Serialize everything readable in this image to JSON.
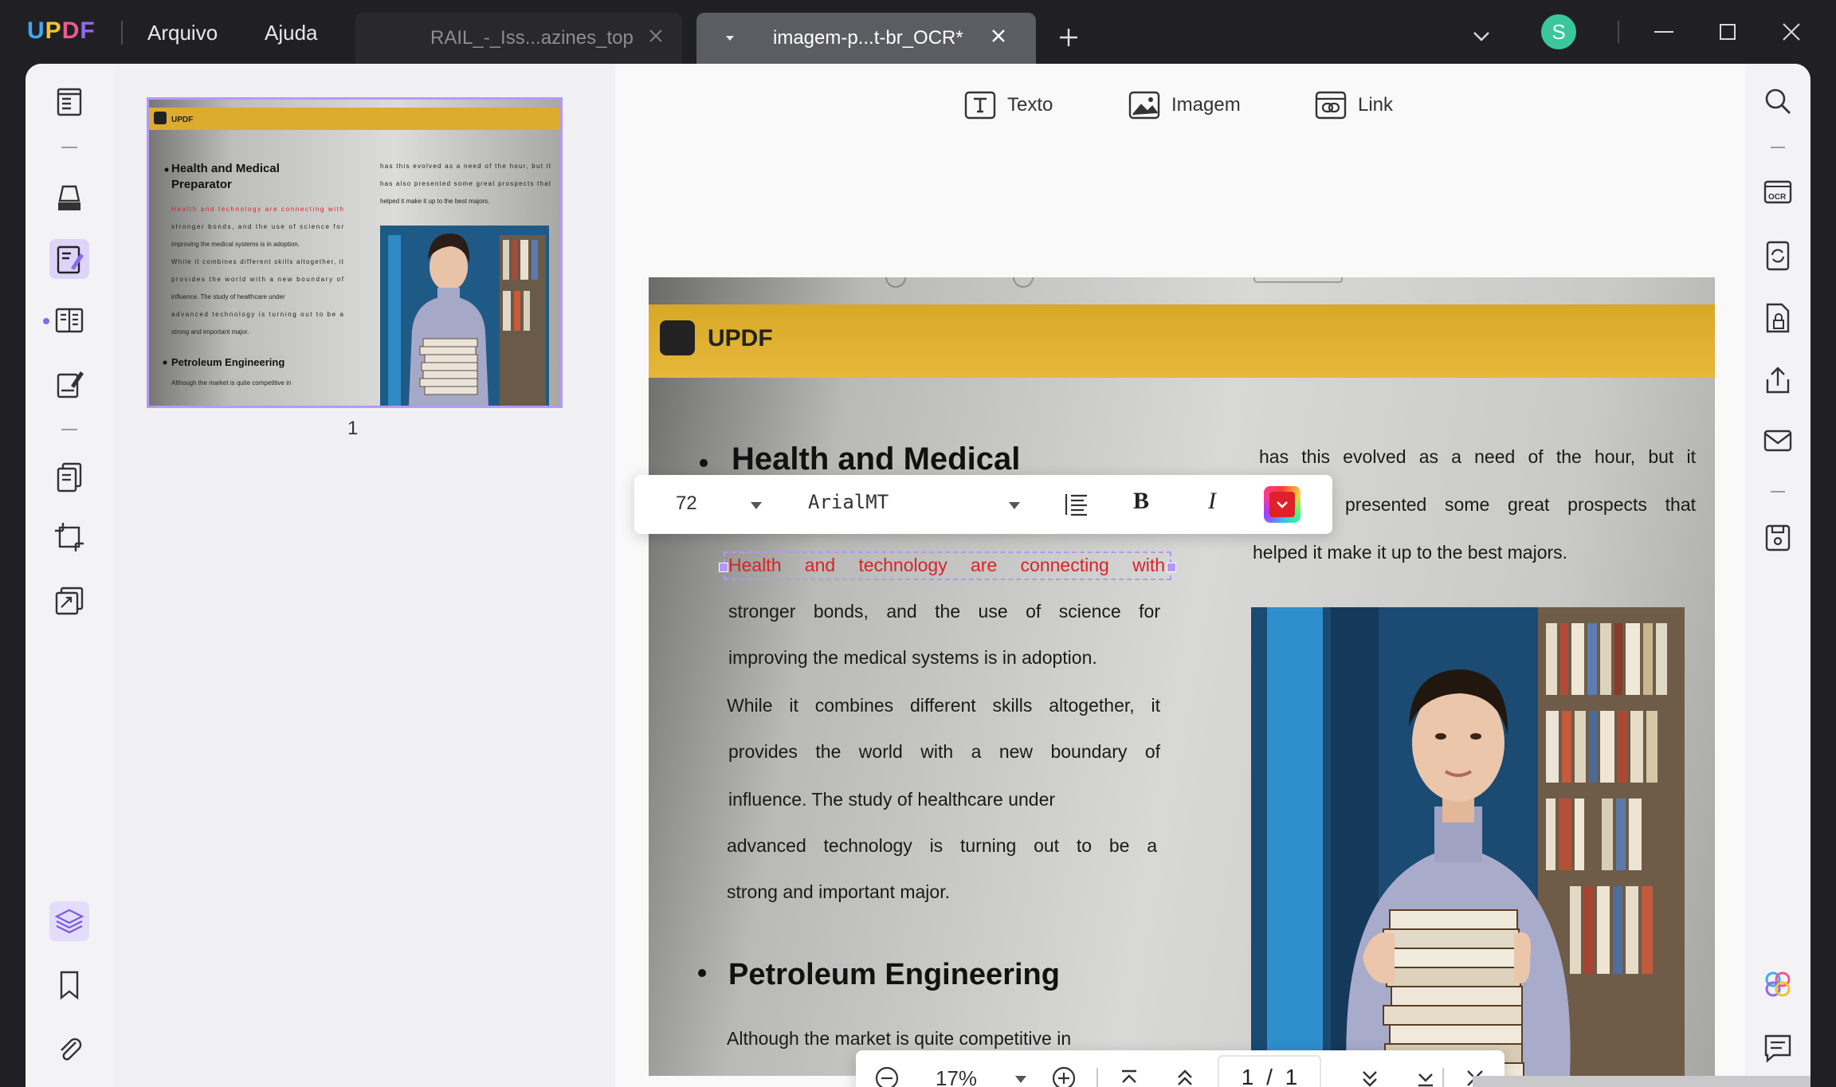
{
  "app": {
    "logo": "UPDF"
  },
  "menu": {
    "file": "Arquivo",
    "help": "Ajuda"
  },
  "tabs": [
    {
      "label": "RAIL_-_Iss...azines_top",
      "active": false
    },
    {
      "label": "imagem-p...t-br_OCR*",
      "active": true
    }
  ],
  "user": {
    "initial": "S",
    "avatar_color": "#3cc79a"
  },
  "edit_tools": {
    "text": "Texto",
    "image": "Imagem",
    "link": "Link"
  },
  "thumbnail": {
    "page_label": "1"
  },
  "format_toolbar": {
    "font_size": "72",
    "font_family": "ArialMT",
    "bold": "B",
    "italic": "I",
    "text_color": "#e0202a"
  },
  "document": {
    "brand": "UPDF",
    "heading1": "Health and Medical",
    "heading1_full": "Health and Medical Preparator",
    "selected_line": "Health and technology are connecting with",
    "left_lines": [
      "stronger bonds, and the use of science for",
      "improving the medical systems is in adoption.",
      "While it combines different skills altogether, it",
      "provides the world with a new boundary of",
      "influence. The study of healthcare under",
      "advanced technology is turning out to be a",
      "strong and important major."
    ],
    "right_lines": [
      "has this evolved as a need of the hour, but it",
      "presented some great prospects that",
      "helped it make it up to the best majors."
    ],
    "thumb_right_lines": [
      "has this evolved as a need of the hour, but it",
      "has also presented some great prospects that",
      "helped it make it up to the best majors."
    ],
    "heading2": "Petroleum Engineering",
    "closing_line": "Although the market is quite competitive in"
  },
  "zoom": {
    "level": "17%",
    "current_page": "1",
    "separator": "/",
    "total_pages": "1"
  },
  "colors": {
    "accent": "#8a6af0",
    "band": "#e0b030",
    "selection": "#b497f6",
    "selected_text": "#d8232a"
  }
}
